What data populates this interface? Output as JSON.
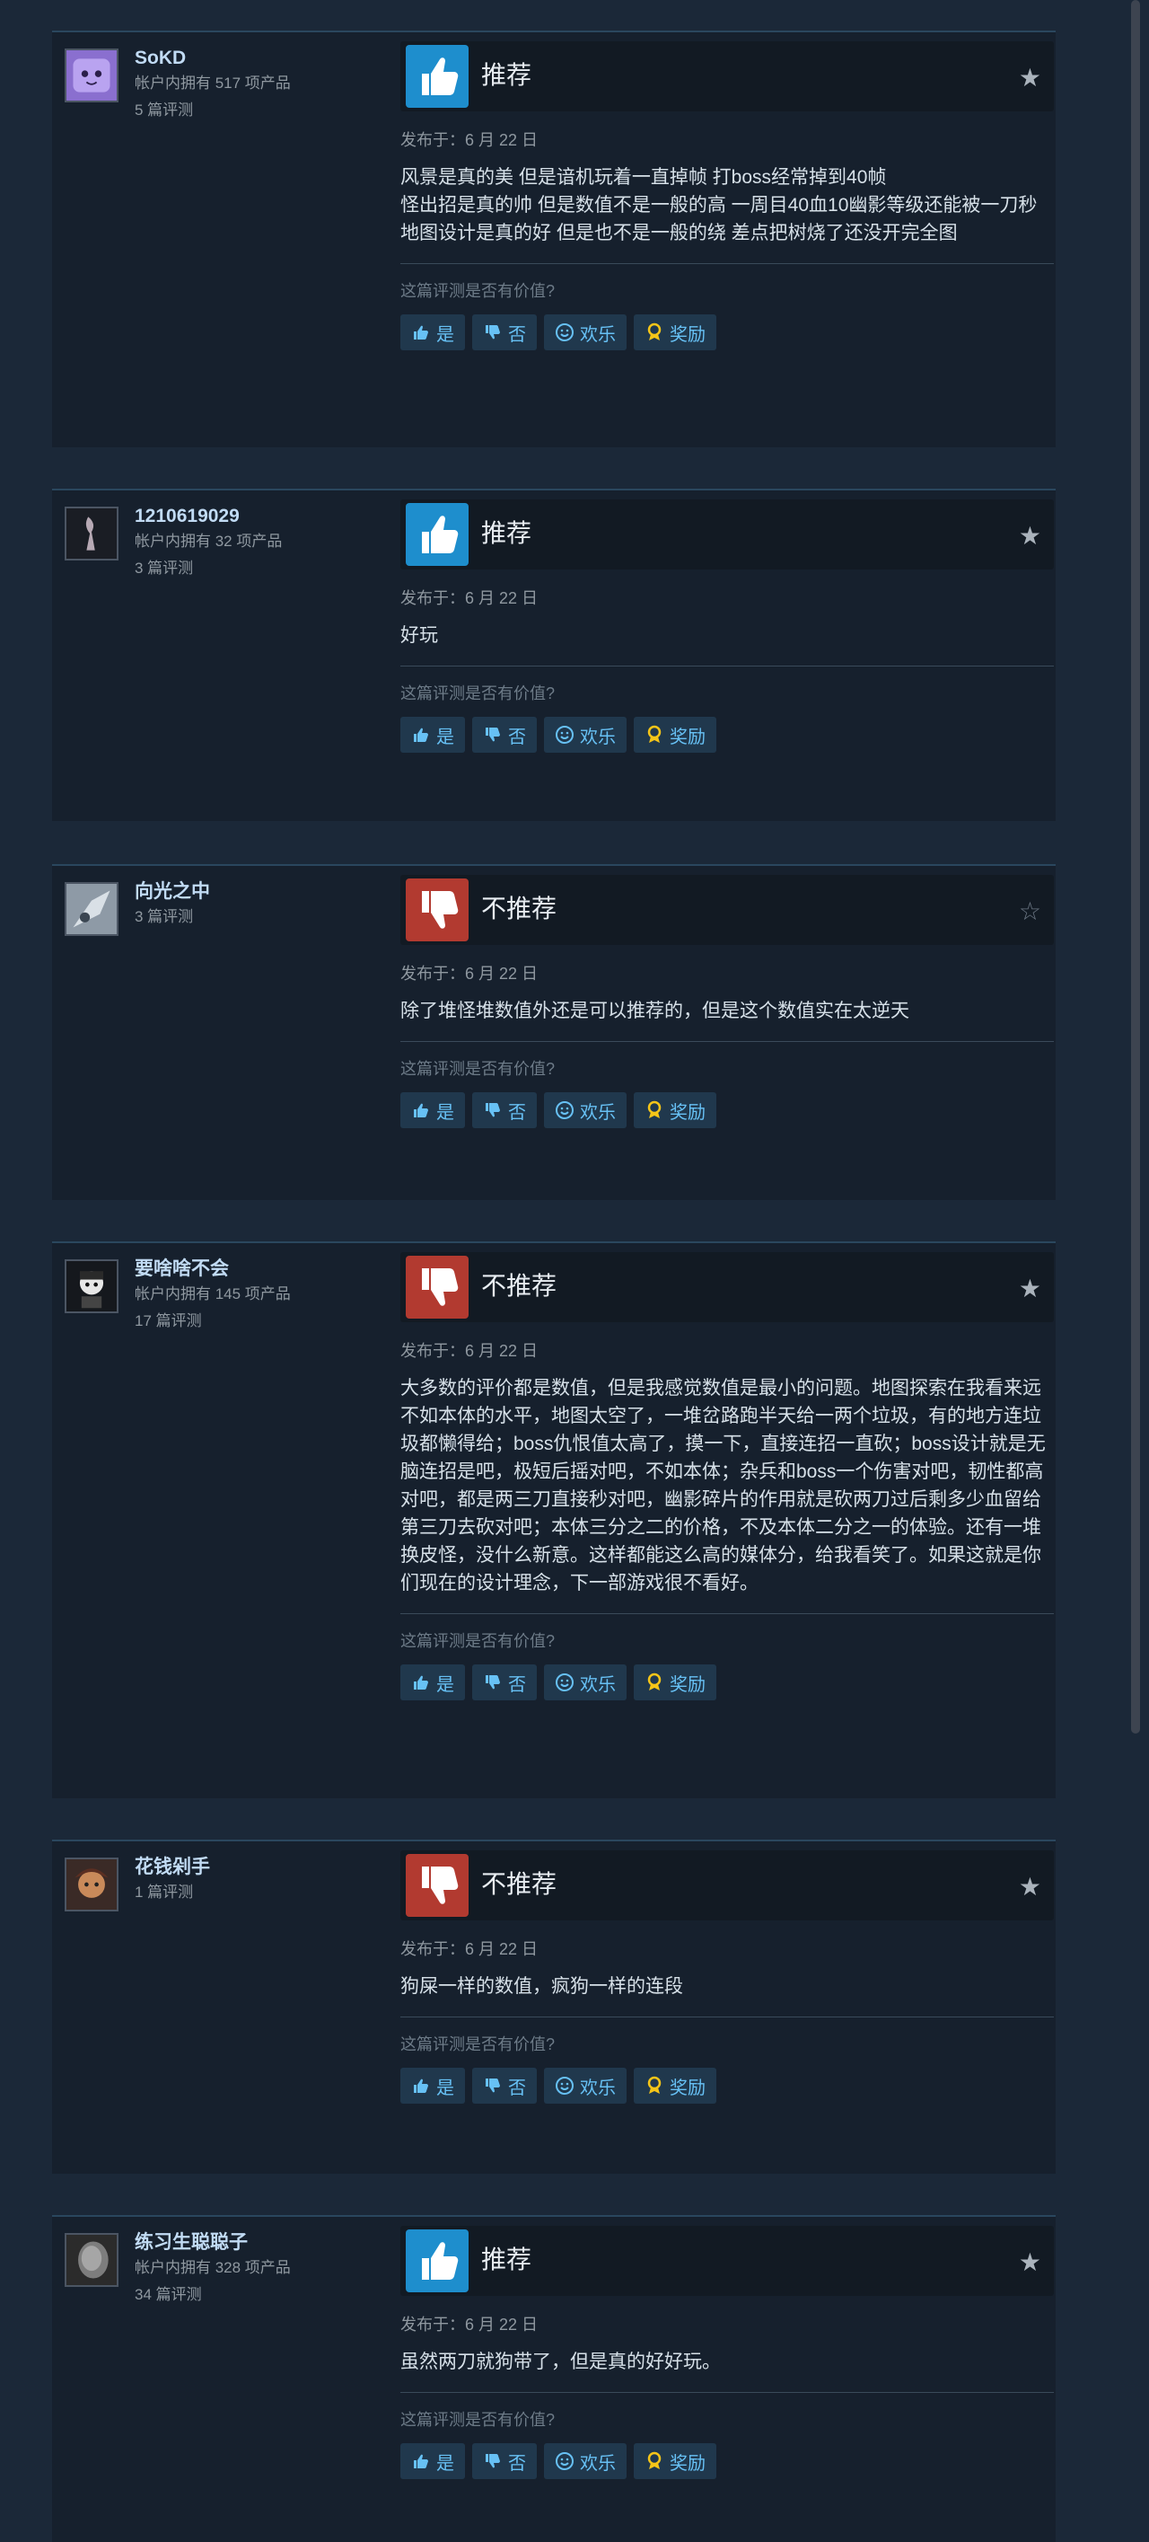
{
  "ui": {
    "helpful_prompt": "这篇评测是否有价值?",
    "buttons": {
      "yes": "是",
      "no": "否",
      "funny": "欢乐",
      "award": "奖励"
    }
  },
  "reviews": [
    {
      "author": "SoKD",
      "products": "帐户内拥有 517 项产品",
      "review_count": "5 篇评测",
      "verdict": "推荐",
      "recommended": true,
      "posted": "发布于：6 月 22 日",
      "content": "风景是真的美 但是谙机玩着一直掉帧 打boss经常掉到40帧\n怪出招是真的帅 但是数值不是一般的高 一周目40血10幽影等级还能被一刀秒\n地图设计是真的好 但是也不是一般的绕 差点把树烧了还没开完全图"
    },
    {
      "author": "1210619029",
      "products": "帐户内拥有 32 项产品",
      "review_count": "3 篇评测",
      "verdict": "推荐",
      "recommended": true,
      "posted": "发布于：6 月 22 日",
      "content": "好玩"
    },
    {
      "author": "向光之中",
      "products": "",
      "review_count": "3 篇评测",
      "verdict": "不推荐",
      "recommended": false,
      "posted": "发布于：6 月 22 日",
      "content": "除了堆怪堆数值外还是可以推荐的，但是这个数值实在太逆天"
    },
    {
      "author": "要啥啥不会",
      "products": "帐户内拥有 145 项产品",
      "review_count": "17 篇评测",
      "verdict": "不推荐",
      "recommended": false,
      "posted": "发布于：6 月 22 日",
      "content": "大多数的评价都是数值，但是我感觉数值是最小的问题。地图探索在我看来远不如本体的水平，地图太空了，一堆岔路跑半天给一两个垃圾，有的地方连垃圾都懒得给；boss仇恨值太高了，摸一下，直接连招一直砍；boss设计就是无脑连招是吧，极短后摇对吧，不如本体；杂兵和boss一个伤害对吧，韧性都高对吧，都是两三刀直接秒对吧，幽影碎片的作用就是砍两刀过后剩多少血留给第三刀去砍对吧；本体三分之二的价格，不及本体二分之一的体验。还有一堆换皮怪，没什么新意。这样都能这么高的媒体分，给我看笑了。如果这就是你们现在的设计理念，下一部游戏很不看好。"
    },
    {
      "author": "花钱剁手",
      "products": "",
      "review_count": "1 篇评测",
      "verdict": "不推荐",
      "recommended": false,
      "posted": "发布于：6 月 22 日",
      "content": "狗屎一样的数值，疯狗一样的连段"
    },
    {
      "author": "练习生聪聪子",
      "products": "帐户内拥有 328 项产品",
      "review_count": "34 篇评测",
      "verdict": "推荐",
      "recommended": true,
      "posted": "发布于：6 月 22 日",
      "content": "虽然两刀就狗带了，但是真的好好玩。"
    }
  ]
}
